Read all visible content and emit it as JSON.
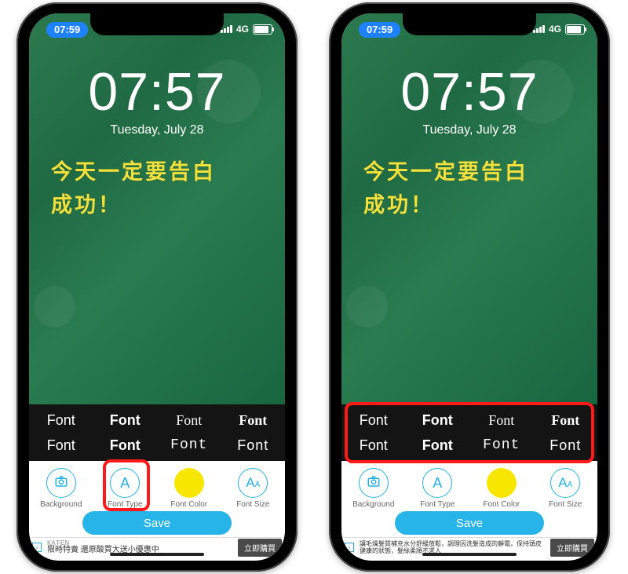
{
  "status": {
    "time_pill": "07:59",
    "network": "4G"
  },
  "lock": {
    "time": "07:57",
    "date": "Tuesday, July 28"
  },
  "handwriting": {
    "line1": "今天一定要告白",
    "line2": "成功！"
  },
  "fontgrid": {
    "r1": [
      "Font",
      "Font",
      "Font",
      "Font"
    ],
    "r2": [
      "Font",
      "Font",
      "Font",
      "Font"
    ]
  },
  "tools": {
    "background": "Background",
    "font_type": "Font Type",
    "font_color": "Font Color",
    "font_size": "Font Size",
    "font_type_letter": "A",
    "font_size_letter_big": "A",
    "font_size_letter_small": "A"
  },
  "save_label": "Save",
  "ad_left": {
    "title": "KA'FEN",
    "text": "限時特賣 還原酸買大送小優惠中",
    "cta": "立即購買"
  },
  "ad_right": {
    "text": "讓毛燥髮質補充水分舒緩放鬆，調理因洗髮造成的靜電，保持頭皮健康的狀態，髮絲柔順不求人",
    "cta": "立即購買"
  }
}
